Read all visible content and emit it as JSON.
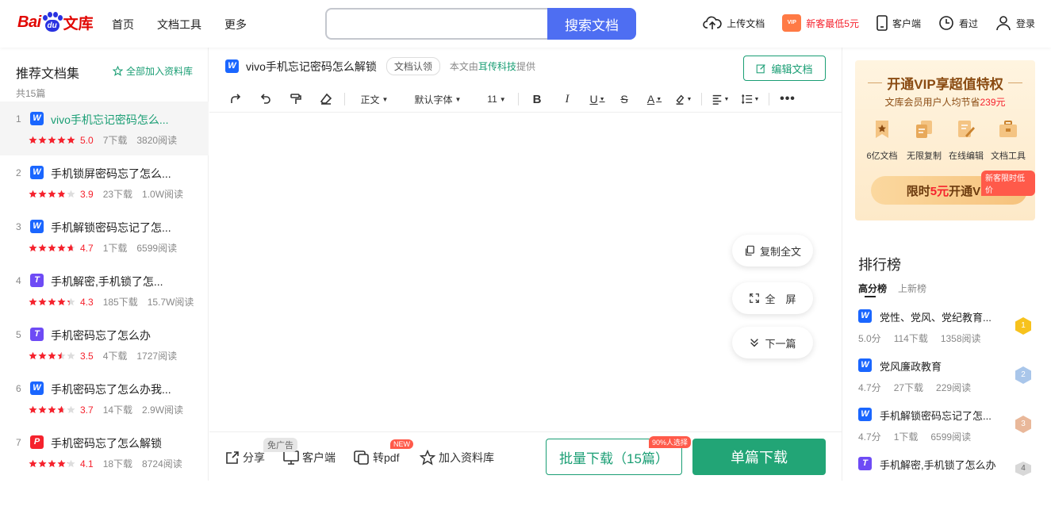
{
  "header": {
    "logo": {
      "bai": "Bai",
      "du": "du",
      "wenku": "文库"
    },
    "nav": [
      "首页",
      "文档工具",
      "更多"
    ],
    "search": {
      "placeholder": "",
      "button": "搜索文档"
    },
    "actions": {
      "upload": "上传文档",
      "vip_gift": "VIP",
      "vip_promo": "新客最低5元",
      "client": "客户端",
      "history": "看过",
      "login": "登录"
    }
  },
  "left": {
    "title": "推荐文档集",
    "count": "共15篇",
    "add_all": "全部加入资料库",
    "items": [
      {
        "num": "1",
        "type": "W",
        "color": "#1a66ff",
        "title": "vivo手机忘记密码怎么...",
        "score": "5.0",
        "rating": 5.0,
        "downloads": "7下载",
        "reads": "3820阅读"
      },
      {
        "num": "2",
        "type": "W",
        "color": "#1a66ff",
        "title": "手机锁屏密码忘了怎么...",
        "score": "3.9",
        "rating": 3.9,
        "downloads": "23下载",
        "reads": "1.0W阅读"
      },
      {
        "num": "3",
        "type": "W",
        "color": "#1a66ff",
        "title": "手机解锁密码忘记了怎...",
        "score": "4.7",
        "rating": 4.7,
        "downloads": "1下载",
        "reads": "6599阅读"
      },
      {
        "num": "4",
        "type": "T",
        "color": "#6e4bf5",
        "title": "手机解密,手机锁了怎...",
        "score": "4.3",
        "rating": 4.3,
        "downloads": "185下载",
        "reads": "15.7W阅读"
      },
      {
        "num": "5",
        "type": "T",
        "color": "#6e4bf5",
        "title": "手机密码忘了怎么办",
        "score": "3.5",
        "rating": 3.5,
        "downloads": "4下载",
        "reads": "1727阅读"
      },
      {
        "num": "6",
        "type": "W",
        "color": "#1a66ff",
        "title": "手机密码忘了怎么办我...",
        "score": "3.7",
        "rating": 3.7,
        "downloads": "14下载",
        "reads": "2.9W阅读"
      },
      {
        "num": "7",
        "type": "P",
        "color": "#f5222d",
        "title": "手机密码忘了怎么解锁",
        "score": "4.1",
        "rating": 4.1,
        "downloads": "18下载",
        "reads": "8724阅读"
      }
    ]
  },
  "main": {
    "title": "vivo手机忘记密码怎么解锁",
    "cert": "文档认领",
    "provider_prefix": "本文由",
    "provider_org": "耳传科技",
    "provider_suffix": "提供",
    "edit": "编辑文档",
    "toolbar": {
      "style": "正文",
      "font": "默认字体",
      "size": "11"
    },
    "float": {
      "copy": "复制全文",
      "fullscreen": "全　屏",
      "next": "下一篇"
    },
    "bottom": {
      "share": "分享",
      "client": "客户端",
      "client_tag": "免广告",
      "topdf": "转pdf",
      "topdf_tag": "NEW",
      "add_library": "加入资料库",
      "batch": "批量下载（15篇）",
      "batch_tag": "90%人选择",
      "single": "单篇下载"
    }
  },
  "right": {
    "vip": {
      "title": "开通VIP享超值特权",
      "sub_prefix": "文库会员用户人均节省",
      "sub_num": "239元",
      "features": [
        "6亿文档",
        "无限复制",
        "在线编辑",
        "文档工具"
      ],
      "open_prefix": "限时",
      "open_num": "5元",
      "open_suffix": "开通VIP",
      "new_tag": "新客限时低价"
    },
    "rank": {
      "title": "排行榜",
      "tabs": [
        "高分榜",
        "上新榜"
      ],
      "items": [
        {
          "type": "W",
          "color": "#1a66ff",
          "name": "党性、党风、党纪教育...",
          "score": "5.0分",
          "downloads": "114下载",
          "reads": "1358阅读",
          "rank": "1",
          "badge": "#f7c21d"
        },
        {
          "type": "W",
          "color": "#1a66ff",
          "name": "党风廉政教育",
          "score": "4.7分",
          "downloads": "27下载",
          "reads": "229阅读",
          "rank": "2",
          "badge": "#a9c6ea"
        },
        {
          "type": "W",
          "color": "#1a66ff",
          "name": "手机解锁密码忘记了怎...",
          "score": "4.7分",
          "downloads": "1下载",
          "reads": "6599阅读",
          "rank": "3",
          "badge": "#e9b89a"
        },
        {
          "type": "T",
          "color": "#6e4bf5",
          "name": "手机解密,手机锁了怎么办",
          "score": "",
          "downloads": "",
          "reads": "",
          "rank": "4",
          "badge": "#d8d8d8"
        }
      ]
    }
  }
}
